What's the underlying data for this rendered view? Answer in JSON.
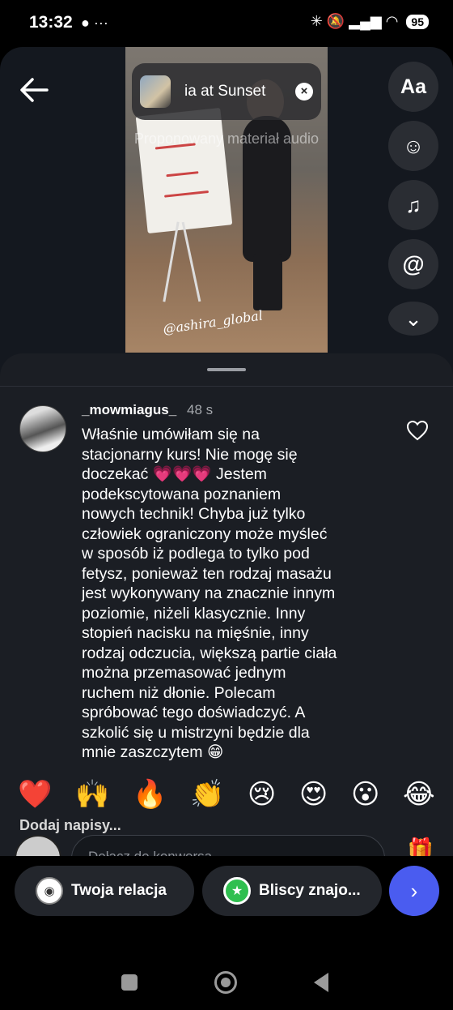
{
  "status_bar": {
    "time": "13:32",
    "left_icons": "● ···",
    "right_icons": "✳ 🔕 ▂▄▆ ◠",
    "battery": "95"
  },
  "editor": {
    "music_title": "ia at Sunset",
    "suggested_audio": "Proponowany materiał audio",
    "watermark": "@ashira_global",
    "tools": {
      "text": "Aa",
      "sticker": "☺",
      "music": "♫",
      "mention": "@",
      "more": "⌄"
    }
  },
  "comment": {
    "username": "_mowmiagus_",
    "time": "48 s",
    "text": "Właśnie umówiłam się na\nstacjonarny kurs! Nie mogę się\ndoczekać 💗💗💗 Jestem\npodekscytowana poznaniem\nnowych technik! Chyba już tylko\nczłowiek ograniczony może myśleć\nw sposób iż podlega to tylko pod\nfetysz, ponieważ ten rodzaj masażu\njest wykonywany na znacznie  innym\npoziomie, niżeli klasycznie. Inny\nstopień nacisku na mięśnie, inny\nrodzaj odczucia, większą partie ciała\nmożna przemasować jednym\nruchem niż dłonie. Polecam\nspróbować tego doświadczyć. A\nszkolić się u mistrzyni będzie dla\nmnie zaszczytem 😁"
  },
  "reactions": [
    "❤️",
    "🙌",
    "🔥",
    "👏",
    "😢",
    "😍",
    "😮",
    "😂"
  ],
  "captions_label": "Dodaj napisy...",
  "reply": {
    "placeholder": "Dołącz do konwersa",
    "gift": "🎁"
  },
  "share": {
    "your_story": "Twoja relacja",
    "close_friends": "Bliscy znajo...",
    "send": "›"
  }
}
